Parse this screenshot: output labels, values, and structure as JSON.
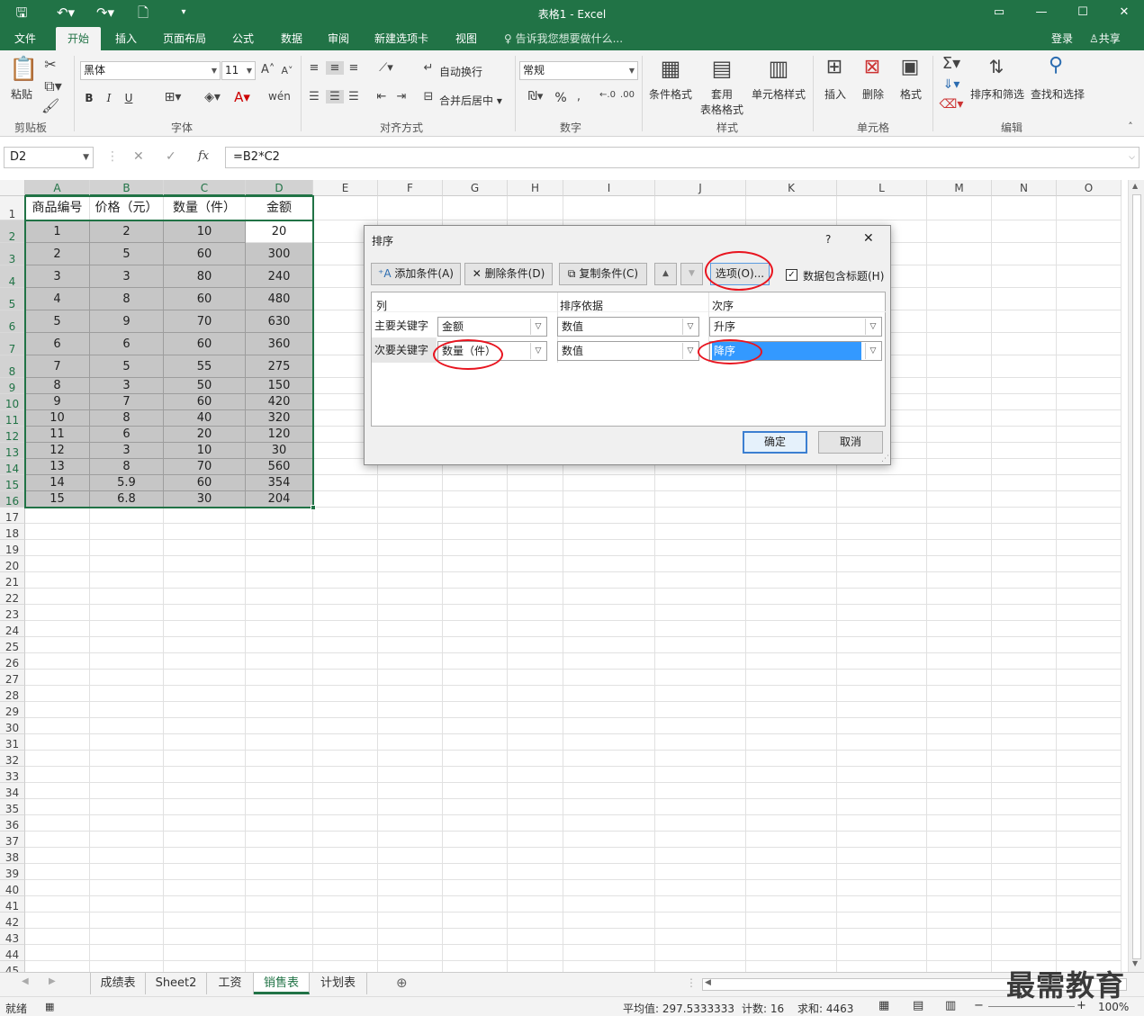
{
  "titlebar": {
    "title": "表格1 - Excel"
  },
  "tabs": [
    "文件",
    "开始",
    "插入",
    "页面布局",
    "公式",
    "数据",
    "审阅",
    "新建选项卡",
    "视图"
  ],
  "tell_me": "告诉我您想要做什么...",
  "login": "登录",
  "share": "共享",
  "ribbon": {
    "paste": "粘贴",
    "font_name": "黑体",
    "font_size": "11",
    "bold": "B",
    "italic": "I",
    "underline": "U",
    "wrap": "自动换行",
    "merge": "合并后居中",
    "number_format": "常规",
    "percent": "%",
    "cond_format": "条件格式",
    "table_format_1": "套用",
    "table_format_2": "表格格式",
    "cell_style": "单元格样式",
    "insert": "插入",
    "delete": "删除",
    "format": "格式",
    "sort_filter": "排序和筛选",
    "find_select": "查找和选择",
    "groups": [
      "剪贴板",
      "字体",
      "对齐方式",
      "数字",
      "样式",
      "单元格",
      "编辑"
    ]
  },
  "formula_bar": {
    "name_box": "D2",
    "fx": "fx",
    "formula": "=B2*C2"
  },
  "columns": [
    "A",
    "B",
    "C",
    "D",
    "E",
    "F",
    "G",
    "H",
    "I",
    "J",
    "K",
    "L",
    "M",
    "N",
    "O"
  ],
  "table": {
    "headers": [
      "商品编号",
      "价格（元）",
      "数量（件）",
      "金额"
    ],
    "rows": [
      [
        "1",
        "2",
        "10",
        "20"
      ],
      [
        "2",
        "5",
        "60",
        "300"
      ],
      [
        "3",
        "3",
        "80",
        "240"
      ],
      [
        "4",
        "8",
        "60",
        "480"
      ],
      [
        "5",
        "9",
        "70",
        "630"
      ],
      [
        "6",
        "6",
        "60",
        "360"
      ],
      [
        "7",
        "5",
        "55",
        "275"
      ],
      [
        "8",
        "3",
        "50",
        "150"
      ],
      [
        "9",
        "7",
        "60",
        "420"
      ],
      [
        "10",
        "8",
        "40",
        "320"
      ],
      [
        "11",
        "6",
        "20",
        "120"
      ],
      [
        "12",
        "3",
        "10",
        "30"
      ],
      [
        "13",
        "8",
        "70",
        "560"
      ],
      [
        "14",
        "5.9",
        "60",
        "354"
      ],
      [
        "15",
        "6.8",
        "30",
        "204"
      ]
    ]
  },
  "row_count": 45,
  "dialog": {
    "title": "排序",
    "help": "?",
    "close": "✕",
    "add_condition": "添加条件(A)",
    "delete_condition": "删除条件(D)",
    "copy_condition": "复制条件(C)",
    "options": "选项(O)...",
    "has_header": "数据包含标题(H)",
    "col_header": "列",
    "basis_header": "排序依据",
    "order_header": "次序",
    "primary_label": "主要关键字",
    "secondary_label": "次要关键字",
    "primary": {
      "column": "金额",
      "basis": "数值",
      "order": "升序"
    },
    "secondary": {
      "column": "数量（件）",
      "basis": "数值",
      "order": "降序"
    },
    "ok": "确定",
    "cancel": "取消"
  },
  "sheets": [
    "成绩表",
    "Sheet2",
    "工资",
    "销售表",
    "计划表"
  ],
  "active_sheet": "销售表",
  "status": {
    "ready": "就绪",
    "average": "平均值: 297.5333333",
    "count": "计数: 16",
    "sum": "求和: 4463",
    "zoom": "100%"
  },
  "watermark": "最需教育",
  "colors": {
    "accent": "#217346",
    "ring": "#e8141f",
    "selection": "#3399ff"
  }
}
